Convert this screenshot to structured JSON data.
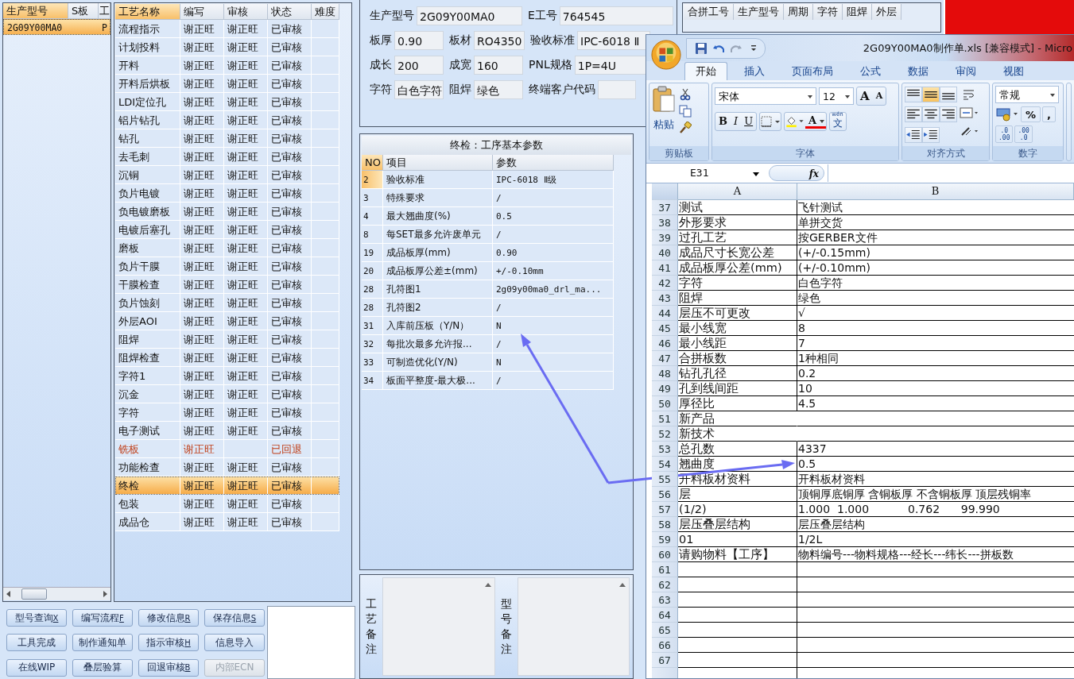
{
  "model_list": {
    "columns": [
      {
        "label": "生产型号",
        "sorted": true
      },
      {
        "label": "S板",
        "sorted": false
      },
      {
        "label": "工",
        "sorted": false
      }
    ],
    "rows": [
      {
        "cells": [
          "2G09Y00MA0",
          "",
          "P"
        ],
        "selected": true
      }
    ]
  },
  "process_table": {
    "columns": [
      {
        "label": "工艺名称",
        "sorted": true
      },
      {
        "label": "编写",
        "sorted": false
      },
      {
        "label": "审核",
        "sorted": false
      },
      {
        "label": "状态",
        "sorted": false
      },
      {
        "label": "难度",
        "sorted": false
      }
    ],
    "rows": [
      {
        "name": "流程指示",
        "author": "谢正旺",
        "reviewer": "谢正旺",
        "status": "已审核",
        "returned": false,
        "selected": false
      },
      {
        "name": "计划投料",
        "author": "谢正旺",
        "reviewer": "谢正旺",
        "status": "已审核",
        "returned": false,
        "selected": false
      },
      {
        "name": "开料",
        "author": "谢正旺",
        "reviewer": "谢正旺",
        "status": "已审核",
        "returned": false,
        "selected": false
      },
      {
        "name": "开料后烘板",
        "author": "谢正旺",
        "reviewer": "谢正旺",
        "status": "已审核",
        "returned": false,
        "selected": false
      },
      {
        "name": "LDI定位孔",
        "author": "谢正旺",
        "reviewer": "谢正旺",
        "status": "已审核",
        "returned": false,
        "selected": false
      },
      {
        "name": "铝片钻孔",
        "author": "谢正旺",
        "reviewer": "谢正旺",
        "status": "已审核",
        "returned": false,
        "selected": false
      },
      {
        "name": "钻孔",
        "author": "谢正旺",
        "reviewer": "谢正旺",
        "status": "已审核",
        "returned": false,
        "selected": false
      },
      {
        "name": "去毛刺",
        "author": "谢正旺",
        "reviewer": "谢正旺",
        "status": "已审核",
        "returned": false,
        "selected": false
      },
      {
        "name": "沉铜",
        "author": "谢正旺",
        "reviewer": "谢正旺",
        "status": "已审核",
        "returned": false,
        "selected": false
      },
      {
        "name": "负片电镀",
        "author": "谢正旺",
        "reviewer": "谢正旺",
        "status": "已审核",
        "returned": false,
        "selected": false
      },
      {
        "name": "负电镀磨板",
        "author": "谢正旺",
        "reviewer": "谢正旺",
        "status": "已审核",
        "returned": false,
        "selected": false
      },
      {
        "name": "电镀后塞孔",
        "author": "谢正旺",
        "reviewer": "谢正旺",
        "status": "已审核",
        "returned": false,
        "selected": false
      },
      {
        "name": "磨板",
        "author": "谢正旺",
        "reviewer": "谢正旺",
        "status": "已审核",
        "returned": false,
        "selected": false
      },
      {
        "name": "负片干膜",
        "author": "谢正旺",
        "reviewer": "谢正旺",
        "status": "已审核",
        "returned": false,
        "selected": false
      },
      {
        "name": "干膜检查",
        "author": "谢正旺",
        "reviewer": "谢正旺",
        "status": "已审核",
        "returned": false,
        "selected": false
      },
      {
        "name": "负片蚀刻",
        "author": "谢正旺",
        "reviewer": "谢正旺",
        "status": "已审核",
        "returned": false,
        "selected": false
      },
      {
        "name": "外层AOI",
        "author": "谢正旺",
        "reviewer": "谢正旺",
        "status": "已审核",
        "returned": false,
        "selected": false
      },
      {
        "name": "阻焊",
        "author": "谢正旺",
        "reviewer": "谢正旺",
        "status": "已审核",
        "returned": false,
        "selected": false
      },
      {
        "name": "阻焊检查",
        "author": "谢正旺",
        "reviewer": "谢正旺",
        "status": "已审核",
        "returned": false,
        "selected": false
      },
      {
        "name": "字符1",
        "author": "谢正旺",
        "reviewer": "谢正旺",
        "status": "已审核",
        "returned": false,
        "selected": false
      },
      {
        "name": "沉金",
        "author": "谢正旺",
        "reviewer": "谢正旺",
        "status": "已审核",
        "returned": false,
        "selected": false
      },
      {
        "name": "字符",
        "author": "谢正旺",
        "reviewer": "谢正旺",
        "status": "已审核",
        "returned": false,
        "selected": false
      },
      {
        "name": "电子测试",
        "author": "谢正旺",
        "reviewer": "谢正旺",
        "status": "已审核",
        "returned": false,
        "selected": false
      },
      {
        "name": "铣板",
        "author": "谢正旺",
        "status": "已回退",
        "returned": true,
        "selected": false
      },
      {
        "name": "功能检查",
        "author": "谢正旺",
        "reviewer": "谢正旺",
        "status": "已审核",
        "returned": false,
        "selected": false
      },
      {
        "name": "终检",
        "author": "谢正旺",
        "reviewer": "谢正旺",
        "status": "已审核",
        "returned": false,
        "selected": true
      },
      {
        "name": "包装",
        "author": "谢正旺",
        "reviewer": "谢正旺",
        "status": "已审核",
        "returned": false,
        "selected": false
      },
      {
        "name": "成品仓",
        "author": "谢正旺",
        "reviewer": "谢正旺",
        "status": "已审核",
        "returned": false,
        "selected": false
      }
    ]
  },
  "buttons": [
    {
      "label": "型号查询",
      "key": "X",
      "disabled": false
    },
    {
      "label": "编写流程",
      "key": "F",
      "disabled": false
    },
    {
      "label": "修改信息",
      "key": "R",
      "disabled": false
    },
    {
      "label": "保存信息",
      "key": "S",
      "disabled": false
    },
    {
      "label": "工具完成",
      "disabled": false
    },
    {
      "label": "制作通知单",
      "disabled": false
    },
    {
      "label": "指示审核",
      "key": "H",
      "disabled": false
    },
    {
      "label": "信息导入",
      "disabled": false
    },
    {
      "label": "在线WIP",
      "disabled": false
    },
    {
      "label": "叠层验算",
      "disabled": false
    },
    {
      "label": "回退审核",
      "key": "B",
      "disabled": false
    },
    {
      "label": "内部ECN",
      "disabled": true
    }
  ],
  "info_form": {
    "rows": [
      [
        {
          "label": "生产型号",
          "value": "2G09Y00MA0"
        },
        "",
        {
          "label": "E工号",
          "value": "764545"
        }
      ],
      [
        {
          "label": "板厚",
          "value": "0.90"
        },
        {
          "label": "板材",
          "value": "RO4350"
        },
        {
          "label": "验收标准",
          "value": "IPC-6018 Ⅱ"
        }
      ],
      [
        {
          "label": "成长",
          "value": "200"
        },
        {
          "label": "成宽",
          "value": "160"
        },
        {
          "label": "PNL规格",
          "value": "1P=4U"
        }
      ],
      [
        {
          "label": "字符",
          "value": "白色字符"
        },
        {
          "label": "阻焊",
          "value": "绿色"
        },
        {
          "label": "终端客户代码"
        }
      ]
    ]
  },
  "params_panel": {
    "title": "终检：工序基本参数",
    "columns": [
      {
        "label": "NO",
        "sorted": true
      },
      {
        "label": "项目",
        "sorted": false
      },
      {
        "label": "参数",
        "sorted": false
      }
    ],
    "rows": [
      {
        "no": "2",
        "item": "验收标准",
        "value": "IPC-6018 Ⅱ级",
        "selected": true
      },
      {
        "no": "3",
        "item": "特殊要求",
        "value": "/",
        "selected": false
      },
      {
        "no": "4",
        "item": "最大翘曲度(%)",
        "value": "0.5",
        "selected": false
      },
      {
        "no": "8",
        "item": "每SET最多允许废单元",
        "value": "/",
        "selected": false
      },
      {
        "no": "19",
        "item": "成品板厚(mm)",
        "value": "0.90",
        "selected": false
      },
      {
        "no": "20",
        "item": "成品板厚公差±(mm)",
        "value": "+/-0.10mm",
        "selected": false
      },
      {
        "no": "28",
        "item": "孔符图1",
        "value": "2g09y00ma0_drl_ma...",
        "selected": false
      },
      {
        "no": "28",
        "item": "孔符图2",
        "value": "/",
        "selected": false
      },
      {
        "no": "31",
        "item": "入库前压板（Y/N）",
        "value": "N",
        "selected": false
      },
      {
        "no": "32",
        "item": "每批次最多允许报...",
        "value": "/",
        "selected": false
      },
      {
        "no": "33",
        "item": "可制造优化(Y/N)",
        "value": "N",
        "selected": false
      },
      {
        "no": "34",
        "item": "板面平整度-最大极...",
        "value": "/",
        "selected": false
      }
    ]
  },
  "remarks": [
    {
      "label": "工艺备注"
    },
    {
      "label": "型号备注"
    }
  ],
  "merge_table": {
    "columns": [
      "合拼工号",
      "生产型号",
      "周期",
      "字符",
      "阻焊",
      "外层"
    ]
  },
  "excel": {
    "title": "2G09Y00MA0制作单.xls  [兼容模式] - Micro",
    "tabs": [
      {
        "label": "开始",
        "selected": true
      },
      {
        "label": "插入",
        "selected": false
      },
      {
        "label": "页面布局",
        "selected": false
      },
      {
        "label": "公式",
        "selected": false
      },
      {
        "label": "数据",
        "selected": false
      },
      {
        "label": "审阅",
        "selected": false
      },
      {
        "label": "视图",
        "selected": false
      }
    ],
    "clipboard": {
      "paste": "粘贴",
      "group": "剪贴板"
    },
    "font": {
      "name": "宋体",
      "size": "12",
      "grow": "A",
      "shrink": "A",
      "styles": [
        "B",
        "I",
        "U"
      ],
      "color_letter": "A",
      "phonetic": "文",
      "phonetic_top": "wén",
      "group": "字体"
    },
    "alignment": {
      "group": "对齐方式",
      "buttons": [
        {
          "kind": "top",
          "selected": false
        },
        {
          "kind": "middle",
          "selected": true
        },
        {
          "kind": "bottom",
          "selected": false
        },
        {
          "kind": "left",
          "selected": false
        },
        {
          "kind": "center",
          "selected": false
        },
        {
          "kind": "right",
          "selected": false
        }
      ]
    },
    "number": {
      "format": "常规",
      "percent": "%",
      "comma": ",",
      "increase": [
        ".0",
        ".00"
      ],
      "decrease": [
        ".00",
        ".0"
      ],
      "group": "数字"
    },
    "name_box": "E31",
    "formula_label": "fx",
    "columns": [
      "A",
      "B"
    ],
    "rows": [
      {
        "num": "37",
        "a": "测试",
        "b": "飞针测试"
      },
      {
        "num": "38",
        "a": "外形要求",
        "b": "单拼交货"
      },
      {
        "num": "39",
        "a": "过孔工艺",
        "b": "按GERBER文件"
      },
      {
        "num": "40",
        "a": "成品尺寸长宽公差",
        "b": "(+/-0.15mm)"
      },
      {
        "num": "41",
        "a": "成品板厚公差(mm)",
        "b": "(+/-0.10mm)"
      },
      {
        "num": "42",
        "a": "字符",
        "b": "白色字符"
      },
      {
        "num": "43",
        "a": "阻焊",
        "b": "绿色"
      },
      {
        "num": "44",
        "a": "层压不可更改",
        "b": "√"
      },
      {
        "num": "45",
        "a": "最小线宽",
        "b": "8"
      },
      {
        "num": "46",
        "a": "最小线距",
        "b": "7"
      },
      {
        "num": "47",
        "a": "合拼板数",
        "b": "1种相同"
      },
      {
        "num": "48",
        "a": "钻孔孔径",
        "b": "0.2"
      },
      {
        "num": "49",
        "a": "孔到线间距",
        "b": "10"
      },
      {
        "num": "50",
        "a": "厚径比",
        "b": "4.5"
      },
      {
        "num": "51",
        "a": "新产品"
      },
      {
        "num": "52",
        "a": "新技术"
      },
      {
        "num": "53",
        "a": "总孔数",
        "b": "4337"
      },
      {
        "num": "54",
        "a": "翘曲度",
        "b": "0.5"
      },
      {
        "num": "55",
        "a": "开料板材资料",
        "b": "开料板材资料"
      },
      {
        "num": "56",
        "a": "层",
        "b": "顶铜厚底铜厚 含铜板厚 不含铜板厚 顶层残铜率"
      },
      {
        "num": "57",
        "a": "(1/2)",
        "b": "1.000  1.000           0.762      99.990"
      },
      {
        "num": "58",
        "a": "层压叠层结构",
        "b": "层压叠层结构"
      },
      {
        "num": "59",
        "a": "01",
        "b": "1/2L"
      },
      {
        "num": "60",
        "a": "请购物料【工序】",
        "b": "物料编号---物料规格---经长---纬长---拼板数"
      },
      {
        "num": "61"
      },
      {
        "num": "62"
      },
      {
        "num": "63"
      },
      {
        "num": "64"
      },
      {
        "num": "65"
      },
      {
        "num": "66"
      },
      {
        "num": "67"
      }
    ]
  }
}
